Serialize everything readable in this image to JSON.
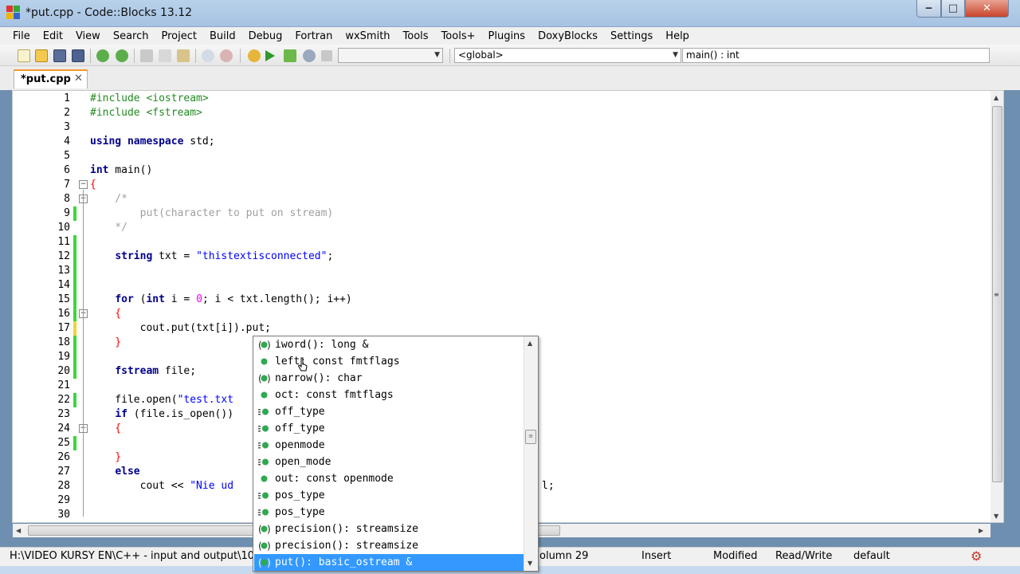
{
  "window": {
    "title": "*put.cpp - Code::Blocks 13.12"
  },
  "menu": [
    "File",
    "Edit",
    "View",
    "Search",
    "Project",
    "Build",
    "Debug",
    "Fortran",
    "wxSmith",
    "Tools",
    "Tools+",
    "Plugins",
    "DoxyBlocks",
    "Settings",
    "Help"
  ],
  "toolbar": {
    "target_combo": "",
    "scope_combo": "<global>",
    "function_combo": "main() : int"
  },
  "tab": {
    "label": "*put.cpp",
    "close": "✕"
  },
  "editor": {
    "lines": [
      {
        "n": "1"
      },
      {
        "n": "2"
      },
      {
        "n": "3"
      },
      {
        "n": "4"
      },
      {
        "n": "5"
      },
      {
        "n": "6"
      },
      {
        "n": "7"
      },
      {
        "n": "8"
      },
      {
        "n": "9"
      },
      {
        "n": "10"
      },
      {
        "n": "11"
      },
      {
        "n": "12"
      },
      {
        "n": "13"
      },
      {
        "n": "14"
      },
      {
        "n": "15"
      },
      {
        "n": "16"
      },
      {
        "n": "17"
      },
      {
        "n": "18"
      },
      {
        "n": "19"
      },
      {
        "n": "20"
      },
      {
        "n": "21"
      },
      {
        "n": "22"
      },
      {
        "n": "23"
      },
      {
        "n": "24"
      },
      {
        "n": "25"
      },
      {
        "n": "26"
      },
      {
        "n": "27"
      },
      {
        "n": "28"
      },
      {
        "n": "29"
      },
      {
        "n": "30"
      }
    ],
    "code": {
      "l1": "#include <iostream>",
      "l2": "#include <fstream>",
      "l4_kw1": "using",
      "l4_kw2": "namespace",
      "l4_rest": " std;",
      "l6_kw": "int",
      "l6_rest": " main()",
      "l7": "{",
      "l8": "    /*",
      "l9": "        put(character to put on stream)",
      "l10": "    */",
      "l12_kw": "string",
      "l12_rest": " txt = ",
      "l12_str": "\"thistextisconnected\"",
      "l12_end": ";",
      "l15_kw": "for",
      "l15_a": " (",
      "l15_kw2": "int",
      "l15_b": " i = ",
      "l15_num": "0",
      "l15_c": "; i < txt.length(); i++)",
      "l16": "    {",
      "l17": "        cout.put(txt[i]).put;",
      "l18": "    }",
      "l20_kw": "fstream",
      "l20_rest": " file;",
      "l22_a": "    file.open(",
      "l22_str": "\"test.txt",
      "l23_kw": "if",
      "l23_rest": " (file.is_open())",
      "l24": "    {",
      "l26": "    }",
      "l27_kw": "else",
      "l28_a": "        cout << ",
      "l28_str": "\"Nie ud",
      "l28_end": "l;"
    }
  },
  "autocomplete": {
    "items": [
      {
        "label": "iword(): long &",
        "icon": "method-icon"
      },
      {
        "label": "left: const fmtflags",
        "icon": "variable-icon"
      },
      {
        "label": "narrow(): char",
        "icon": "method-icon"
      },
      {
        "label": "oct: const fmtflags",
        "icon": "variable-icon"
      },
      {
        "label": "off_type",
        "icon": "typedef-icon"
      },
      {
        "label": "off_type",
        "icon": "typedef-icon"
      },
      {
        "label": "openmode",
        "icon": "typedef-icon"
      },
      {
        "label": "open_mode",
        "icon": "typedef-icon"
      },
      {
        "label": "out: const openmode",
        "icon": "variable-icon"
      },
      {
        "label": "pos_type",
        "icon": "typedef-icon"
      },
      {
        "label": "pos_type",
        "icon": "typedef-icon"
      },
      {
        "label": "precision(): streamsize",
        "icon": "method-icon"
      },
      {
        "label": "precision(): streamsize",
        "icon": "method-icon"
      },
      {
        "label": "put(): basic_ostream &",
        "icon": "method-icon",
        "selected": true
      }
    ]
  },
  "status": {
    "path": "H:\\VIDEO KURSY EN\\C++ - input and output\\10.",
    "position": "olumn 29",
    "mode": "Insert",
    "modified": "Modified",
    "access": "Read/Write",
    "encoding": "default"
  },
  "colors": {
    "accent": "#3399ff",
    "keyword": "#00008b",
    "preprocessor": "#228b22",
    "string": "#0000ff",
    "comment": "#a0a0a0",
    "number": "#ff00ff",
    "change_marker": "#3ed63e",
    "tab_highlight": "#f29a28"
  }
}
